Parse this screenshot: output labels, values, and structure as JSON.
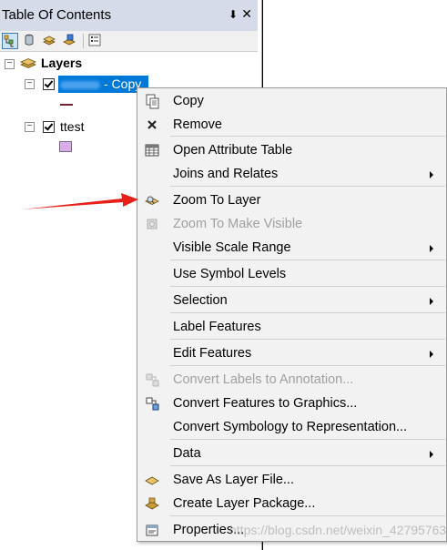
{
  "toc": {
    "title": "Table Of Contents",
    "pin_glyph": "⬇",
    "close_glyph": "✕",
    "toolbar": [
      {
        "name": "list-by-drawing-order-icon",
        "active": true
      },
      {
        "name": "list-by-source-icon",
        "active": false
      },
      {
        "name": "list-by-visibility-icon",
        "active": false
      },
      {
        "name": "list-by-selection-icon",
        "active": false
      },
      {
        "name": "options-icon",
        "active": false
      }
    ],
    "layers_label": "Layers",
    "selected_layer_label": "- Copy",
    "second_layer_label": "ttest",
    "expander_glyph": "−"
  },
  "context_menu": {
    "items": [
      {
        "label": "Copy",
        "icon": "copy-icon",
        "disabled": false,
        "submenu": false
      },
      {
        "label": "Remove",
        "icon": "remove-icon",
        "disabled": false,
        "submenu": false
      },
      {
        "label": "Open Attribute Table",
        "icon": "table-icon",
        "disabled": false,
        "submenu": false
      },
      {
        "label": "Joins and Relates",
        "icon": "",
        "disabled": false,
        "submenu": true
      },
      {
        "label": "Zoom To Layer",
        "icon": "zoom-to-layer-icon",
        "disabled": false,
        "submenu": false
      },
      {
        "label": "Zoom To Make Visible",
        "icon": "zoom-visible-icon",
        "disabled": true,
        "submenu": false
      },
      {
        "label": "Visible Scale Range",
        "icon": "",
        "disabled": false,
        "submenu": true
      },
      {
        "label": "Use Symbol Levels",
        "icon": "",
        "disabled": false,
        "submenu": false
      },
      {
        "label": "Selection",
        "icon": "",
        "disabled": false,
        "submenu": true
      },
      {
        "label": "Label Features",
        "icon": "",
        "disabled": false,
        "submenu": false
      },
      {
        "label": "Edit Features",
        "icon": "",
        "disabled": false,
        "submenu": true
      },
      {
        "label": "Convert Labels to Annotation...",
        "icon": "convert-labels-icon",
        "disabled": true,
        "submenu": false
      },
      {
        "label": "Convert Features to Graphics...",
        "icon": "convert-features-icon",
        "disabled": false,
        "submenu": false
      },
      {
        "label": "Convert Symbology to Representation...",
        "icon": "",
        "disabled": false,
        "submenu": false
      },
      {
        "label": "Data",
        "icon": "",
        "disabled": false,
        "submenu": true
      },
      {
        "label": "Save As Layer File...",
        "icon": "layer-file-icon",
        "disabled": false,
        "submenu": false
      },
      {
        "label": "Create Layer Package...",
        "icon": "layer-package-icon",
        "disabled": false,
        "submenu": false
      },
      {
        "label": "Properties...",
        "icon": "properties-icon",
        "disabled": false,
        "submenu": false
      }
    ]
  },
  "watermark": "https://blog.csdn.net/weixin_42795763",
  "colors": {
    "selection": "#0078d7",
    "menu_background": "#f2f2f2",
    "annotation_arrow": "#e8201a"
  }
}
